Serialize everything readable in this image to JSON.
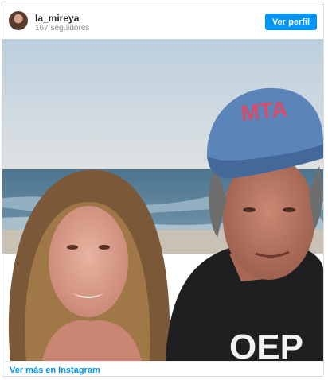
{
  "header": {
    "username": "la_mireya",
    "followers": "167 seguidores",
    "profile_button": "Ver perfil"
  },
  "photo": {
    "cap_text": "MTA"
  },
  "footer": {
    "link_text": "Ver más en Instagram"
  },
  "colors": {
    "accent": "#0095f6",
    "cap": "#5b84b8",
    "sky": "#c9d8e2"
  }
}
